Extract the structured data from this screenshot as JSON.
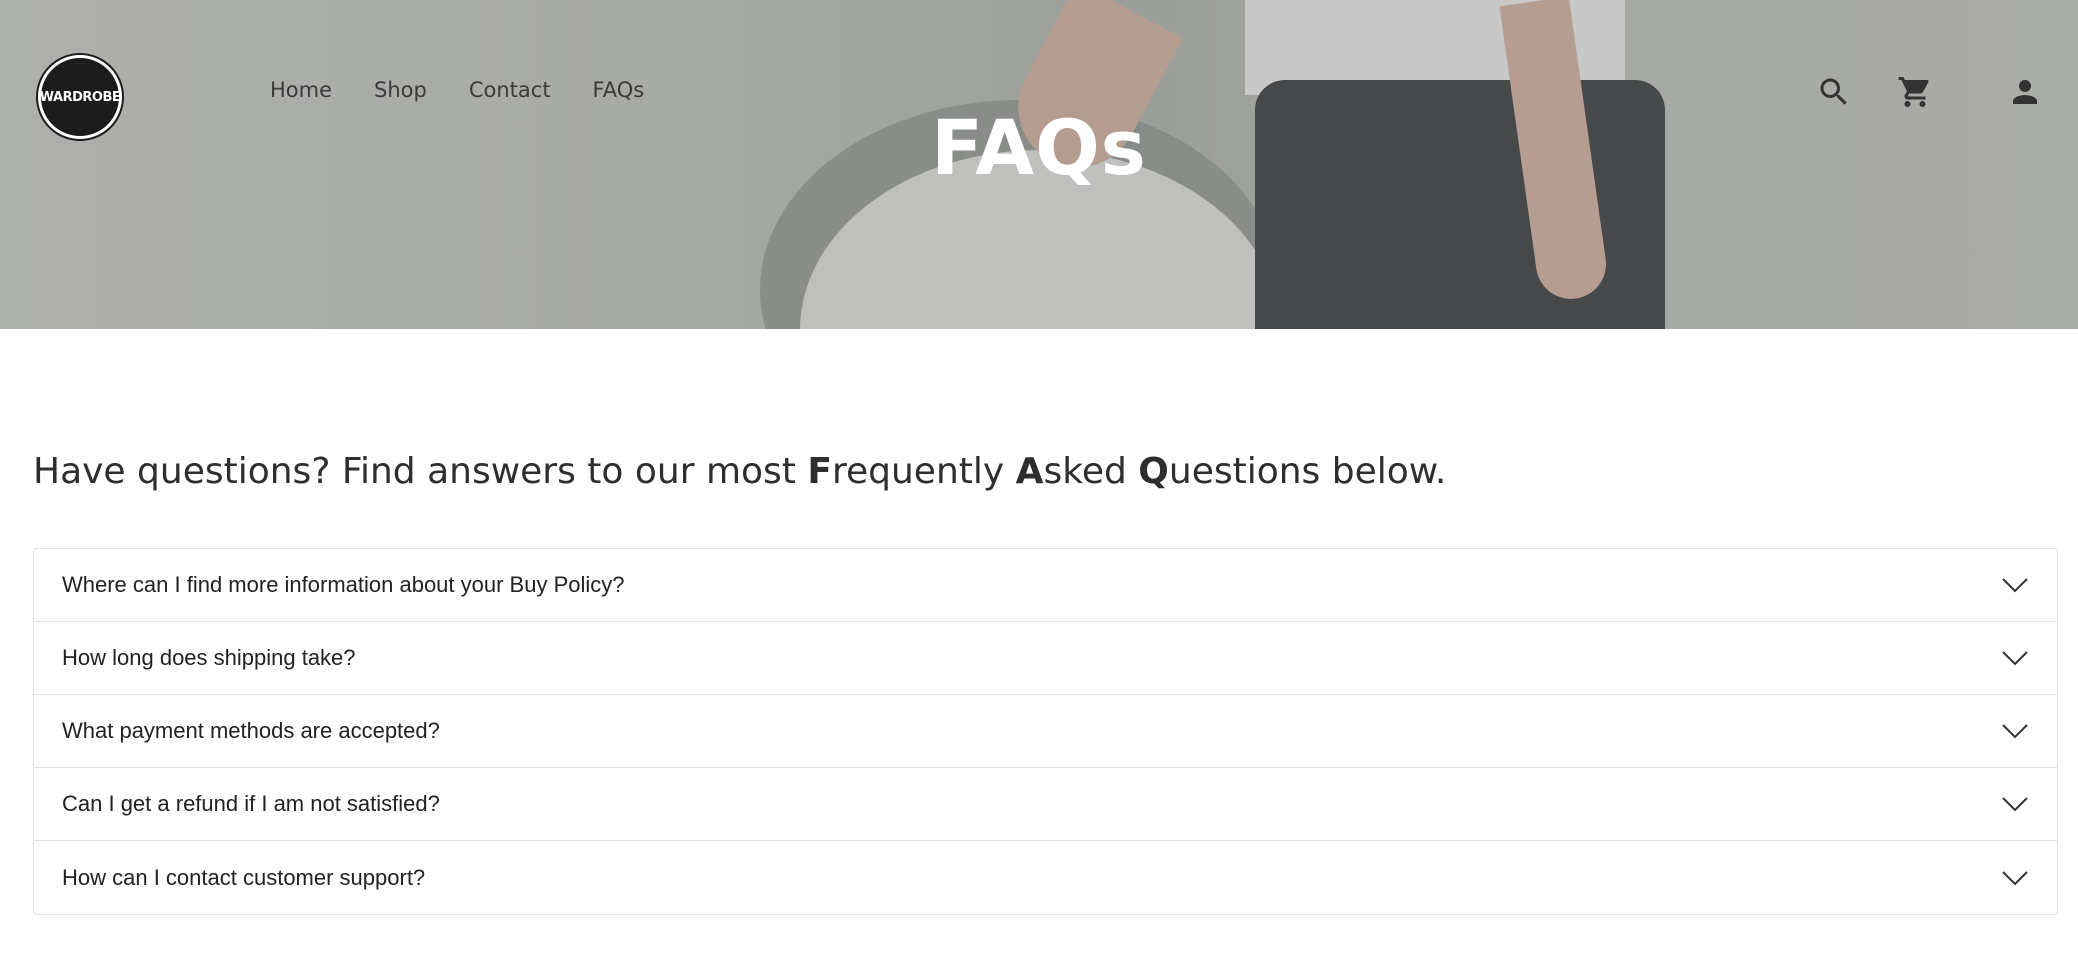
{
  "brand": {
    "logo_text": "WARDROBE"
  },
  "nav": {
    "items": [
      {
        "label": "Home"
      },
      {
        "label": "Shop"
      },
      {
        "label": "Contact"
      },
      {
        "label": "FAQs"
      }
    ]
  },
  "header_icons": [
    "search-icon",
    "cart-icon",
    "account-icon"
  ],
  "hero": {
    "title": "FAQs"
  },
  "intro": {
    "p1": "Have questions? Find answers to our most ",
    "b1": "F",
    "p2": "requently ",
    "b2": "A",
    "p3": "sked ",
    "b3": "Q",
    "p4": "uestions below."
  },
  "faq": {
    "items": [
      {
        "question": "Where can I find more information about your Buy Policy?"
      },
      {
        "question": "How long does shipping take?"
      },
      {
        "question": "What payment methods are accepted?"
      },
      {
        "question": "Can I get a refund if I am not satisfied?"
      },
      {
        "question": "How can I contact customer support?"
      }
    ]
  },
  "colors": {
    "text": "#2b2b2b",
    "border": "#e2e2e2",
    "hero_title": "#ffffff"
  }
}
